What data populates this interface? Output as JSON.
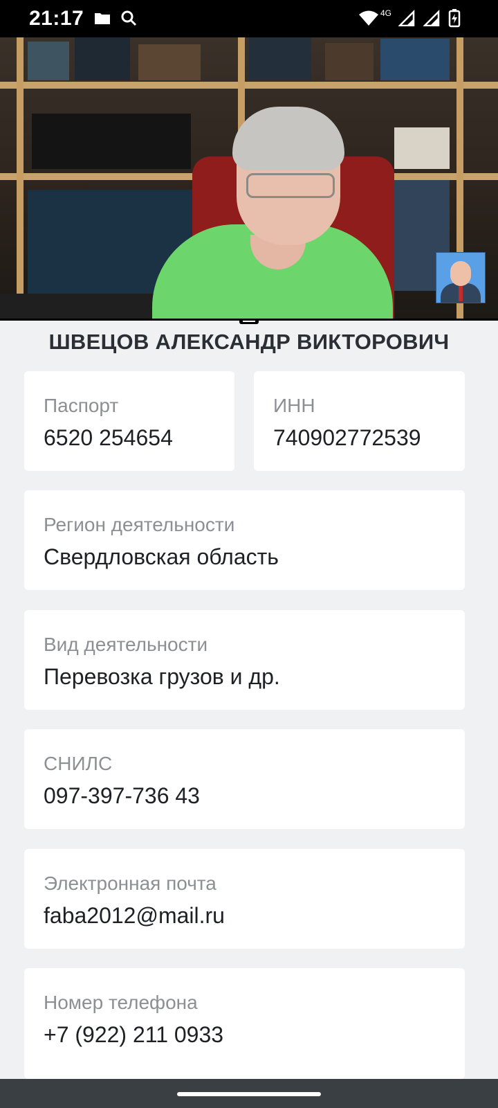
{
  "status_bar": {
    "time": "21:17",
    "network_label": "4G",
    "icons": [
      "folder-icon",
      "search-icon",
      "wifi-icon",
      "signal-icon",
      "signal-icon-2",
      "battery-charging-icon"
    ]
  },
  "video_call": {
    "main_participant": "video-feed",
    "pip_participant": "pip-video-feed"
  },
  "profile": {
    "full_name": "ШВЕЦОВ АЛЕКСАНДР ВИКТОРОВИЧ",
    "passport": {
      "label": "Паспорт",
      "value": "6520 254654"
    },
    "inn": {
      "label": "ИНН",
      "value": "740902772539"
    },
    "region": {
      "label": "Регион деятельности",
      "value": "Свердловская область"
    },
    "activity": {
      "label": "Вид деятельности",
      "value": "Перевозка грузов и др."
    },
    "snils": {
      "label": "СНИЛС",
      "value": "097-397-736 43"
    },
    "email": {
      "label": "Электронная почта",
      "value": "faba2012@mail.ru"
    },
    "phone": {
      "label": "Номер телефона",
      "value": "+7 (922) 211 0933"
    }
  },
  "colors": {
    "background": "#f0f1f3",
    "card": "#ffffff",
    "label": "#8c8f93",
    "value": "#1d2024",
    "title": "#2a2f36"
  }
}
